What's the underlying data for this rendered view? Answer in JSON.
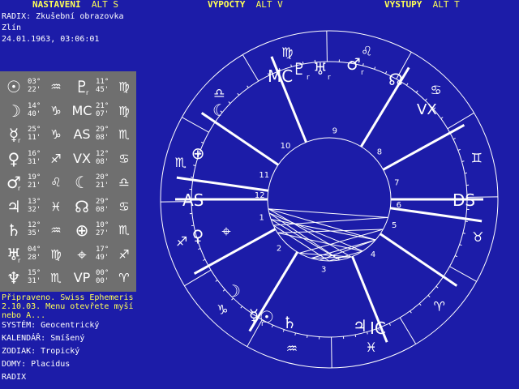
{
  "menu": [
    {
      "label": "NASTAVENÍ",
      "alt": "ALT S"
    },
    {
      "label": "VÝPOČTY",
      "alt": "ALT V"
    },
    {
      "label": "VÝSTUPY",
      "alt": "ALT T"
    }
  ],
  "radix": {
    "title": "RADIX: Zkušební obrazovka",
    "place": "Zlín",
    "datetime": "24.01.1963, 03:06:01"
  },
  "planets_left": [
    {
      "glyph": "☉",
      "sub": "",
      "deg": "03°",
      "min": "22'",
      "sign": "♒"
    },
    {
      "glyph": "☽",
      "sub": "",
      "deg": "14°",
      "min": "40'",
      "sign": "♑"
    },
    {
      "glyph": "☿",
      "sub": "r",
      "deg": "25°",
      "min": "11'",
      "sign": "♑"
    },
    {
      "glyph": "♀",
      "sub": "",
      "deg": "16°",
      "min": "31'",
      "sign": "♐"
    },
    {
      "glyph": "♂",
      "sub": "r",
      "deg": "19°",
      "min": "21'",
      "sign": "♌"
    },
    {
      "glyph": "♃",
      "sub": "",
      "deg": "13°",
      "min": "32'",
      "sign": "♓"
    },
    {
      "glyph": "♄",
      "sub": "",
      "deg": "12°",
      "min": "35'",
      "sign": "♒"
    },
    {
      "glyph": "♅",
      "sub": "r",
      "deg": "04°",
      "min": "28'",
      "sign": "♍"
    },
    {
      "glyph": "♆",
      "sub": "",
      "deg": "15°",
      "min": "31'",
      "sign": "♏"
    }
  ],
  "planets_right": [
    {
      "glyph": "♇",
      "sub": "r",
      "deg": "11°",
      "min": "45'",
      "sign": "♍"
    },
    {
      "glyph": "MC",
      "sub": "",
      "deg": "21°",
      "min": "07'",
      "sign": "♍"
    },
    {
      "glyph": "AS",
      "sub": "",
      "deg": "29°",
      "min": "08'",
      "sign": "♏"
    },
    {
      "glyph": "VX",
      "sub": "",
      "deg": "12°",
      "min": "08'",
      "sign": "♋"
    },
    {
      "glyph": "☾",
      "sub": "",
      "deg": "20°",
      "min": "21'",
      "sign": "♎"
    },
    {
      "glyph": "☊",
      "sub": "",
      "deg": "29°",
      "min": "08'",
      "sign": "♋"
    },
    {
      "glyph": "⊕",
      "sub": "",
      "deg": "10°",
      "min": "27'",
      "sign": "♏"
    },
    {
      "glyph": "⌖",
      "sub": "",
      "deg": "17°",
      "min": "49'",
      "sign": "♐"
    },
    {
      "glyph": "VP",
      "sub": "",
      "deg": "00°",
      "min": "00'",
      "sign": "♈"
    }
  ],
  "status": "Připraveno. Swiss Ephemeris 2.10.03. Menu otevřete myší nebo A...",
  "settings": {
    "system": "SYSTÉM: Geocentrický",
    "calendar": "KALENDÁŘ: Smíšený",
    "zodiac": "ZODIAK: Tropický",
    "houses": "DOMY: Placidus",
    "mode": "RADIX"
  },
  "chart_labels": {
    "asc": "AS",
    "dsc": "DS",
    "mc": "MC",
    "ic": "IC",
    "vx": "VX"
  },
  "house_numbers": [
    "1",
    "2",
    "3",
    "4",
    "5",
    "6",
    "7",
    "8",
    "9",
    "10",
    "11",
    "12"
  ],
  "zodiac_glyphs": [
    "♏",
    "♐",
    "♑",
    "♒",
    "♓",
    "♈",
    "♉",
    "♊",
    "♋",
    "♌",
    "♍",
    "♎"
  ],
  "chart_planets": [
    {
      "name": "pluto",
      "glyph": "♇",
      "sub": "r"
    },
    {
      "name": "uranus",
      "glyph": "♅",
      "sub": "r"
    },
    {
      "name": "mars",
      "glyph": "♂",
      "sub": "r"
    },
    {
      "name": "node",
      "glyph": "☊",
      "sub": ""
    },
    {
      "name": "lilith",
      "glyph": "☾",
      "sub": ""
    },
    {
      "name": "fortune",
      "glyph": "⊕",
      "sub": ""
    },
    {
      "name": "venus",
      "glyph": "♀",
      "sub": ""
    },
    {
      "name": "vertex-point",
      "glyph": "⌖",
      "sub": ""
    },
    {
      "name": "moon",
      "glyph": "☽",
      "sub": ""
    },
    {
      "name": "mercury",
      "glyph": "☿",
      "sub": "r"
    },
    {
      "name": "sun",
      "glyph": "☉",
      "sub": ""
    },
    {
      "name": "saturn",
      "glyph": "♄",
      "sub": ""
    },
    {
      "name": "jupiter",
      "glyph": "♃",
      "sub": ""
    }
  ]
}
